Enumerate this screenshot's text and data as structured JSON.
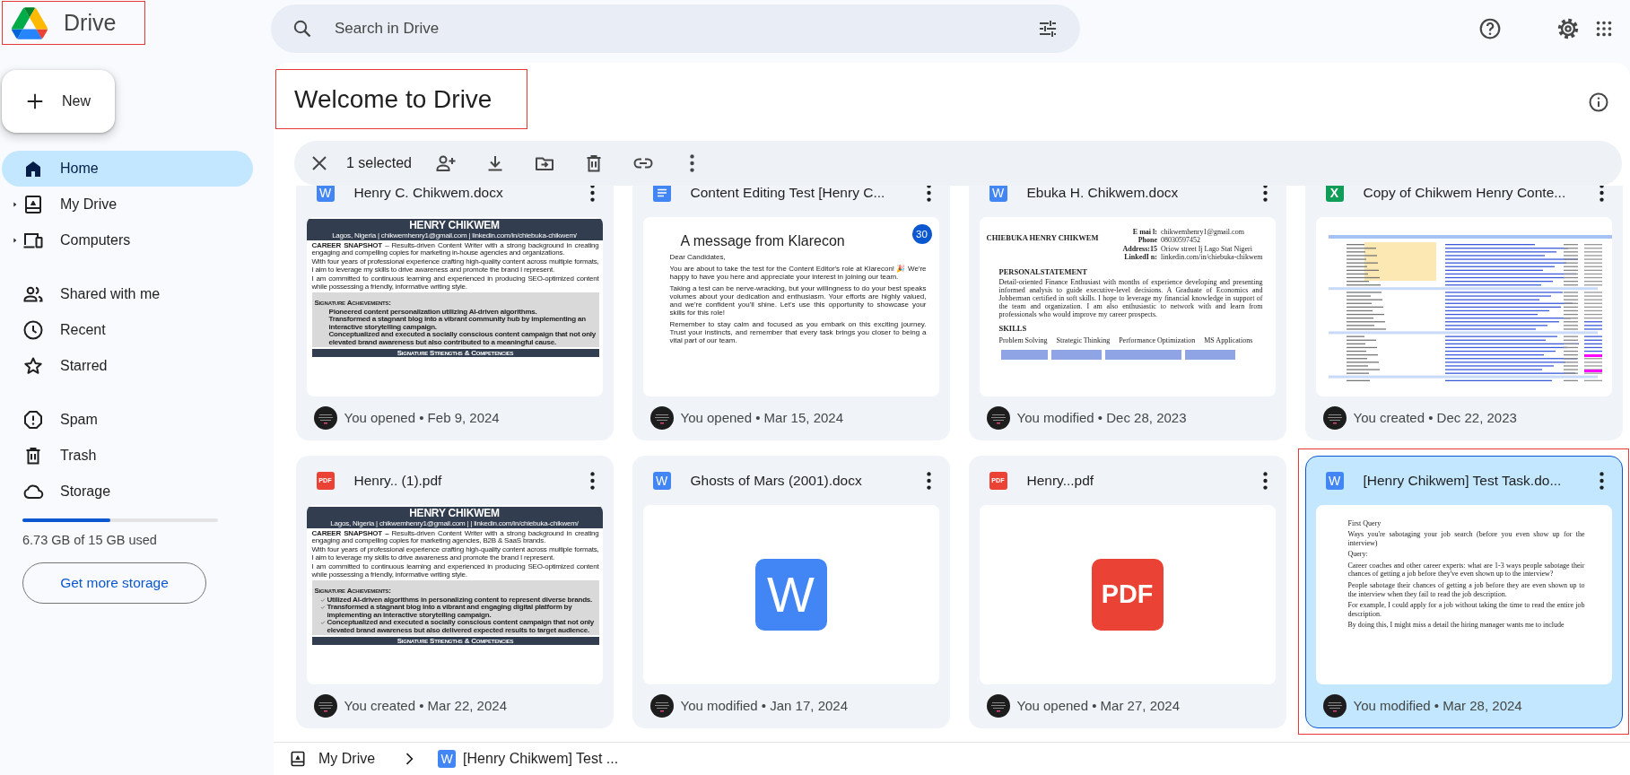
{
  "app": {
    "name": "Drive",
    "highlighted": true
  },
  "search": {
    "placeholder": "Search in Drive"
  },
  "new_button": {
    "label": "New"
  },
  "sidebar": {
    "sections": [
      {
        "items": [
          {
            "label": "Home",
            "kind": "home",
            "selected": true,
            "expandable": false
          },
          {
            "label": "My Drive",
            "kind": "my_drive",
            "selected": false,
            "expandable": true
          },
          {
            "label": "Computers",
            "kind": "computers",
            "selected": false,
            "expandable": true
          }
        ]
      },
      {
        "items": [
          {
            "label": "Shared with me",
            "kind": "shared",
            "selected": false,
            "expandable": false
          },
          {
            "label": "Recent",
            "kind": "recent",
            "selected": false,
            "expandable": false
          },
          {
            "label": "Starred",
            "kind": "starred",
            "selected": false,
            "expandable": false
          }
        ]
      },
      {
        "items": [
          {
            "label": "Spam",
            "kind": "spam",
            "selected": false,
            "expandable": false
          },
          {
            "label": "Trash",
            "kind": "trash",
            "selected": false,
            "expandable": false
          },
          {
            "label": "Storage",
            "kind": "storage",
            "selected": false,
            "expandable": false
          }
        ]
      }
    ]
  },
  "storage": {
    "level": 0.449,
    "text": "6.73 GB of 15 GB used",
    "button": "Get more storage"
  },
  "heading": {
    "text": "Welcome to Drive",
    "highlighted": true
  },
  "selection_bar": {
    "count_label": "1 selected"
  },
  "files": [
    {
      "name": "Henry C. Chikwem.docx",
      "kind": "word",
      "type_label": "W",
      "selected": false,
      "highlighted": false,
      "activity": "You opened • Feb 9, 2024",
      "preview": {
        "kind": "resume",
        "title": "HENRY CHIKWEM",
        "contact": "Lagos, Nigeria | chikwemhenry1@gmail.com | linkedin.com/in/chiebuka-chikwem/",
        "paragraphs": [
          "**CAREER SNAPSHOT** – Results-driven Content Writer with a strong background in creating engaging and compelling copies for marketing in-house agencies and organizations.",
          "With four years of professional experience crafting high-quality content across multiple formats, I aim to leverage my skills to drive awareness and promote the brand I represent.",
          "I am committed to continuous learning and experienced in producing SEO-optimized content while possessing a friendly, informative writing style."
        ],
        "list_title": "Signature Achievements:",
        "checkmarks": false,
        "items": [
          "Pioneered content personalization utilizing AI-driven algorithms.",
          "Transformed a stagnant blog into a vibrant community hub by implementing an interactive storytelling campaign.",
          "Conceptualized and executed a socially conscious content campaign that not only elevated brand awareness but also contributed to a meaningful cause."
        ],
        "footer": "Signature Strengths & Competencies"
      }
    },
    {
      "name": "Content Editing Test [Henry C...",
      "kind": "docs",
      "selected": false,
      "highlighted": false,
      "activity": "You opened • Mar 15, 2024",
      "preview": {
        "kind": "letter",
        "badge": "30",
        "title": "A message from Klarecon",
        "paragraphs": [
          "Dear Candidates,",
          "You are about to take the test for the Content Editor's role at Klarecon! 🎉 We're happy to have you here and appreciate your interest in joining our team.",
          "Taking a test can be nerve-wracking, but your willingness to do your best speaks volumes about your dedication and enthusiasm. Your efforts are highly valued, and we're confident you'll shine. Let's use this opportunity to showcase your skills for this role!",
          "Remember to stay calm and focused as you embark on this exciting journey. Trust your instincts, and remember that every task brings you closer to being a vital part of our team."
        ]
      }
    },
    {
      "name": "Ebuka H. Chikwem.docx",
      "kind": "word",
      "type_label": "W",
      "selected": false,
      "highlighted": false,
      "activity": "You modified • Dec 28, 2023",
      "preview": {
        "kind": "cv",
        "name": "CHIEBUKA HENRY CHIKWEM",
        "contact": [
          {
            "label": "E mai l:",
            "value": "chikwemhenry1@gmail.com"
          },
          {
            "label": "Phone",
            "value": "08030597452"
          },
          {
            "label": "Address:15",
            "value": "Oriow street Ij Lago Stat Nigeri"
          },
          {
            "label": "LinkedI n:",
            "value": "linkedin.com/in/chiebuka-chikwem"
          }
        ],
        "statement_title": "PERSONALSTATEMENT",
        "statement": "Detail-oriented Finance Enthusiast with months of experience developing and presenting informed analysis to guide executive-level decisions. A Graduate of Economics and Jobberman certified in soft skills. I hope to leverage my financial knowledge in support of the team and organization. I am also enthusiastic to network with and learn from professionals who would improve my career prospects.",
        "skills_title": "SKILLS",
        "skills": [
          "Problem Solving",
          "Strategic Thinking",
          "Performance Optimization",
          "MS Applications"
        ]
      }
    },
    {
      "name": "Copy of Chikwem Henry Conte...",
      "kind": "sheet",
      "type_label": "X",
      "selected": false,
      "highlighted": false,
      "activity": "You created • Dec 22, 2023",
      "preview": {
        "kind": "sheet"
      }
    },
    {
      "name": "Henry.. (1).pdf",
      "kind": "pdf",
      "type_label": "PDF",
      "selected": false,
      "highlighted": false,
      "activity": "You created • Mar 22, 2024",
      "preview": {
        "kind": "resume",
        "title": "HENRY CHIKWEM",
        "contact": "Lagos, Nigeria | chikwemhenry1@gmail.com | | linkedin.com/in/chiebuka-chikwem/",
        "paragraphs": [
          "**CAREER SNAPSHOT –** Results-driven Content Writer with a strong background in creating engaging and compelling copies for marketing agencies, B2B & SaaS brands.",
          "With four years of professional experience crafting high-quality content across multiple formats, I aim to leverage my skills to drive awareness and promote the brand I represent.",
          "I am committed to continuous learning and experienced in producing SEO-optimized content while possessing a friendly, informative writing style."
        ],
        "list_title": "Signature Achievements:",
        "checkmarks": true,
        "items": [
          "Utilized AI-driven algorithms in personalizing content to represent diverse brands.",
          "Transformed a stagnant blog into a vibrant and engaging digital platform by implementing an interactive storytelling campaign.",
          "Conceptualized and executed a socially conscious content campaign that not only elevated brand awareness but also delivered expected results to target audience."
        ],
        "footer": "Signature Strengths & Competencies"
      }
    },
    {
      "name": "Ghosts of Mars (2001).docx",
      "kind": "word",
      "type_label": "W",
      "selected": false,
      "highlighted": false,
      "activity": "You modified • Jan 17, 2024",
      "preview": {
        "kind": "icon",
        "label": "W"
      }
    },
    {
      "name": "Henry...pdf",
      "kind": "pdf",
      "type_label": "PDF",
      "selected": false,
      "highlighted": false,
      "activity": "You opened • Mar 27, 2024",
      "preview": {
        "kind": "icon",
        "label": "PDF"
      }
    },
    {
      "name": "[Henry Chikwem] Test Task.do...",
      "kind": "word",
      "type_label": "W",
      "selected": true,
      "highlighted": true,
      "activity": "You modified • Mar 28, 2024",
      "preview": {
        "kind": "query",
        "paragraphs": [
          "First Query",
          "Ways you're sabotaging your job search (before you even show up for the interview)",
          "Query:",
          "Career coaches and other career experts: what are 1-3 ways people sabotage their chances of getting a job before they've even shown up to the interview?",
          "People sabotage their chances of getting a job before they are even shown up to the interview when they fail to read the job description.",
          "For example, I could apply for a job without taking the time to read the entire job description.",
          "By doing this, I might miss a detail the hiring manager wants me to include"
        ]
      }
    }
  ],
  "breadcrumb": [
    {
      "label": "My Drive",
      "kind": "drive"
    },
    {
      "label": "[Henry Chikwem] Test ...",
      "kind": "word",
      "type_label": "W"
    }
  ]
}
